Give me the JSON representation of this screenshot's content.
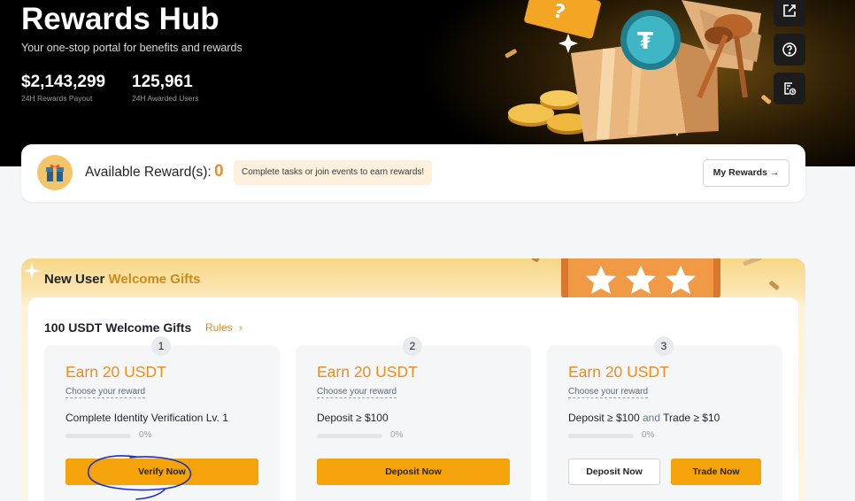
{
  "hero": {
    "title": "Rewards Hub",
    "subtitle": "Your one-stop portal for benefits and rewards",
    "stats": [
      {
        "value": "$2,143,299",
        "label": "24H Rewards Payout"
      },
      {
        "value": "125,961",
        "label": "24H Awarded Users"
      }
    ]
  },
  "side_buttons": [
    "share-icon",
    "help-icon",
    "history-icon"
  ],
  "reward_bar": {
    "label": "Available Reward(s):",
    "count": "0",
    "tip": "Complete tasks or join events to earn rewards!",
    "my_rewards": "My Rewards →"
  },
  "gifts": {
    "title_prefix": "New User",
    "title_highlight": "Welcome Gifts",
    "subtitle": "100 USDT Welcome Gifts",
    "rules": "Rules",
    "rules_arrow": "›",
    "cards": [
      {
        "step": "1",
        "earn": "Earn 20 USDT",
        "choose": "Choose your reward",
        "task": "Complete Identity Verification Lv. 1",
        "progress": "0%",
        "button": "Verify Now"
      },
      {
        "step": "2",
        "earn": "Earn 20 USDT",
        "choose": "Choose your reward",
        "task": "Deposit ≥ $100",
        "progress": "0%",
        "button": "Deposit Now"
      },
      {
        "step": "3",
        "earn": "Earn 20 USDT",
        "choose": "Choose your reward",
        "task_part1": "Deposit ≥ $100",
        "task_connector": "and",
        "task_part2": "Trade ≥ $10",
        "progress": "0%",
        "button_secondary": "Deposit Now",
        "button": "Trade Now"
      }
    ]
  },
  "colors": {
    "accent": "#f08c1a",
    "button": "#f5a30b",
    "hero_bg": "#000000",
    "annotation": "#1a2ec8"
  }
}
